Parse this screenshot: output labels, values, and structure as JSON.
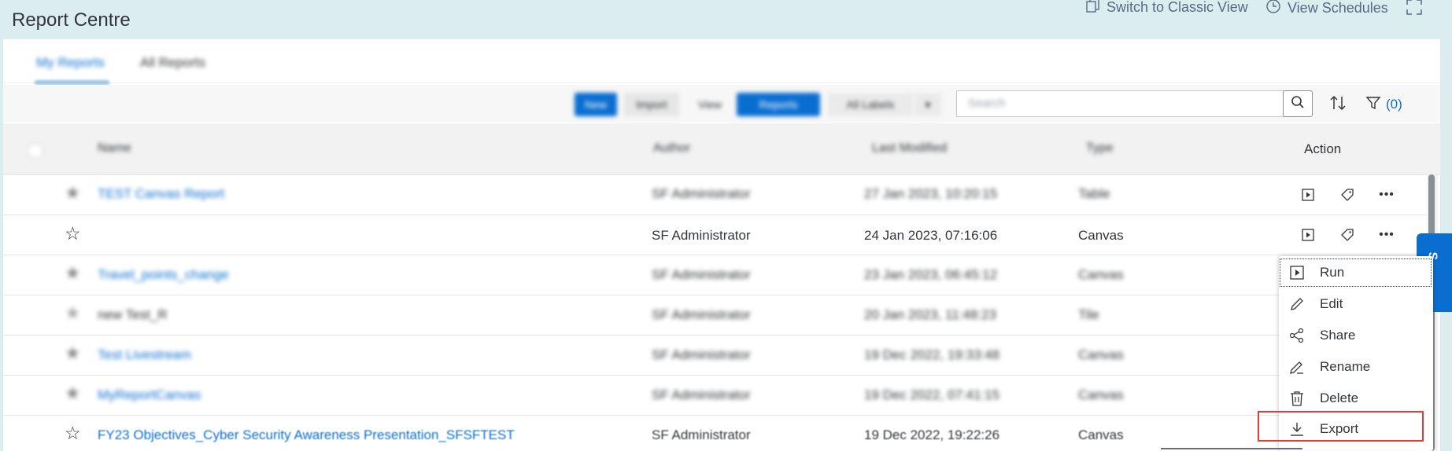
{
  "header": {
    "title": "Report Centre",
    "switch_classic": "Switch to Classic View",
    "view_schedules": "View Schedules"
  },
  "tabs": [
    {
      "label": "My Reports"
    },
    {
      "label": "All Reports"
    }
  ],
  "toolbar": {
    "new_label": "New",
    "import_label": "Import",
    "view_label": "View",
    "reports_label": "Reports",
    "all_labels": "All Labels",
    "search_placeholder": "Search",
    "filter_label": "(0)"
  },
  "table": {
    "columns": [
      "Name",
      "Author",
      "Last Modified",
      "Type"
    ],
    "action_header": "Action",
    "rows": [
      {
        "name": "TEST Canvas Report",
        "author": "SF Administrator",
        "modified": "27 Jan 2023, 10:20:15",
        "type": "Table"
      },
      {
        "name": "",
        "author": "SF Administrator",
        "modified": "24 Jan 2023, 07:16:06",
        "type": "Canvas"
      },
      {
        "name": "Travel_points_change",
        "author": "SF Administrator",
        "modified": "23 Jan 2023, 06:45:12",
        "type": "Canvas"
      },
      {
        "name": "new Test_R",
        "author": "SF Administrator",
        "modified": "20 Jan 2023, 11:48:23",
        "type": "Tile"
      },
      {
        "name": "Test Livestream",
        "author": "SF Administrator",
        "modified": "19 Dec 2022, 19:33:48",
        "type": "Canvas"
      },
      {
        "name": "MyReportCanvas",
        "author": "SF Administrator",
        "modified": "19 Dec 2022, 07:41:15",
        "type": "Canvas"
      },
      {
        "name": "FY23 Objectives_Cyber Security Awareness Presentation_SFSFTEST",
        "author": "SF Administrator",
        "modified": "19 Dec 2022, 19:22:26",
        "type": "Canvas"
      }
    ]
  },
  "menu": {
    "items": [
      {
        "label": "Run",
        "icon": "run-icon"
      },
      {
        "label": "Edit",
        "icon": "pencil-icon"
      },
      {
        "label": "Share",
        "icon": "share-icon"
      },
      {
        "label": "Rename",
        "icon": "rename-icon"
      },
      {
        "label": "Delete",
        "icon": "trash-icon"
      },
      {
        "label": "Export",
        "icon": "download-icon"
      }
    ]
  },
  "side_tab": {
    "label": "S"
  },
  "colors": {
    "accent": "#0a6ed1",
    "highlight": "#e03c3c",
    "background": "#dcedf0"
  }
}
